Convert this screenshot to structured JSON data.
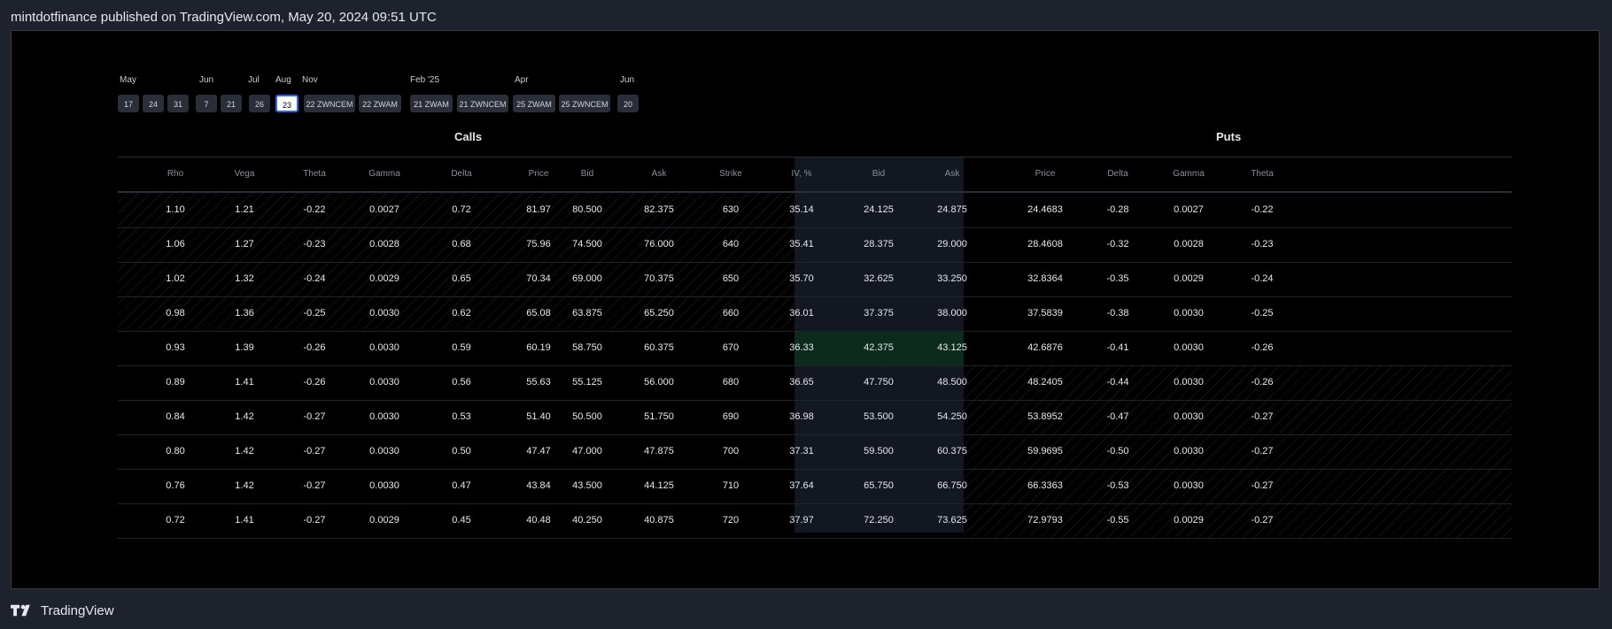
{
  "header": {
    "text": "mintdotfinance published on TradingView.com, May 20, 2024 09:51 UTC"
  },
  "footer": {
    "brand": "TradingView"
  },
  "expirations": {
    "months": [
      "May",
      "Jun",
      "Jul",
      "Aug",
      "Nov",
      "Feb '25",
      "Apr",
      "Jun"
    ],
    "dates": [
      "17",
      "24",
      "31",
      "7",
      "21",
      "26",
      "23",
      "22 ZWNCEM",
      "22 ZWAM",
      "21 ZWAM",
      "21 ZWNCEM",
      "25 ZWAM",
      "25 ZWNCEM",
      "20"
    ],
    "selected": "23"
  },
  "table": {
    "calls_title": "Calls",
    "puts_title": "Puts",
    "headers": [
      "Rho",
      "Vega",
      "Theta",
      "Gamma",
      "Delta",
      "Price",
      "Bid",
      "Ask",
      "Strike",
      "IV, %",
      "Bid",
      "Ask",
      "Price",
      "Delta",
      "Gamma",
      "Theta"
    ],
    "atm_strike": "670",
    "rows": [
      [
        "1.10",
        "1.21",
        "-0.22",
        "0.0027",
        "0.72",
        "81.97",
        "80.500",
        "82.375",
        "630",
        "35.14",
        "24.125",
        "24.875",
        "24.4683",
        "-0.28",
        "0.0027",
        "-0.22"
      ],
      [
        "1.06",
        "1.27",
        "-0.23",
        "0.0028",
        "0.68",
        "75.96",
        "74.500",
        "76.000",
        "640",
        "35.41",
        "28.375",
        "29.000",
        "28.4608",
        "-0.32",
        "0.0028",
        "-0.23"
      ],
      [
        "1.02",
        "1.32",
        "-0.24",
        "0.0029",
        "0.65",
        "70.34",
        "69.000",
        "70.375",
        "650",
        "35.70",
        "32.625",
        "33.250",
        "32.8364",
        "-0.35",
        "0.0029",
        "-0.24"
      ],
      [
        "0.98",
        "1.36",
        "-0.25",
        "0.0030",
        "0.62",
        "65.08",
        "63.875",
        "65.250",
        "660",
        "36.01",
        "37.375",
        "38.000",
        "37.5839",
        "-0.38",
        "0.0030",
        "-0.25"
      ],
      [
        "0.93",
        "1.39",
        "-0.26",
        "0.0030",
        "0.59",
        "60.19",
        "58.750",
        "60.375",
        "670",
        "36.33",
        "42.375",
        "43.125",
        "42.6876",
        "-0.41",
        "0.0030",
        "-0.26"
      ],
      [
        "0.89",
        "1.41",
        "-0.26",
        "0.0030",
        "0.56",
        "55.63",
        "55.125",
        "56.000",
        "680",
        "36.65",
        "47.750",
        "48.500",
        "48.2405",
        "-0.44",
        "0.0030",
        "-0.26"
      ],
      [
        "0.84",
        "1.42",
        "-0.27",
        "0.0030",
        "0.53",
        "51.40",
        "50.500",
        "51.750",
        "690",
        "36.98",
        "53.500",
        "54.250",
        "53.8952",
        "-0.47",
        "0.0030",
        "-0.27"
      ],
      [
        "0.80",
        "1.42",
        "-0.27",
        "0.0030",
        "0.50",
        "47.47",
        "47.000",
        "47.875",
        "700",
        "37.31",
        "59.500",
        "60.375",
        "59.9695",
        "-0.50",
        "0.0030",
        "-0.27"
      ],
      [
        "0.76",
        "1.42",
        "-0.27",
        "0.0030",
        "0.47",
        "43.84",
        "43.500",
        "44.125",
        "710",
        "37.64",
        "65.750",
        "66.750",
        "66.3363",
        "-0.53",
        "0.0030",
        "-0.27"
      ],
      [
        "0.72",
        "1.41",
        "-0.27",
        "0.0029",
        "0.45",
        "40.48",
        "40.250",
        "40.875",
        "720",
        "37.97",
        "72.250",
        "73.625",
        "72.9793",
        "-0.55",
        "0.0029",
        "-0.27"
      ]
    ]
  },
  "colors": {
    "background": "#1e222d",
    "table_bg": "#000000",
    "strike_band": "#131722",
    "atm_highlight": "#0c2b1c",
    "selected_border": "#2962ff"
  }
}
